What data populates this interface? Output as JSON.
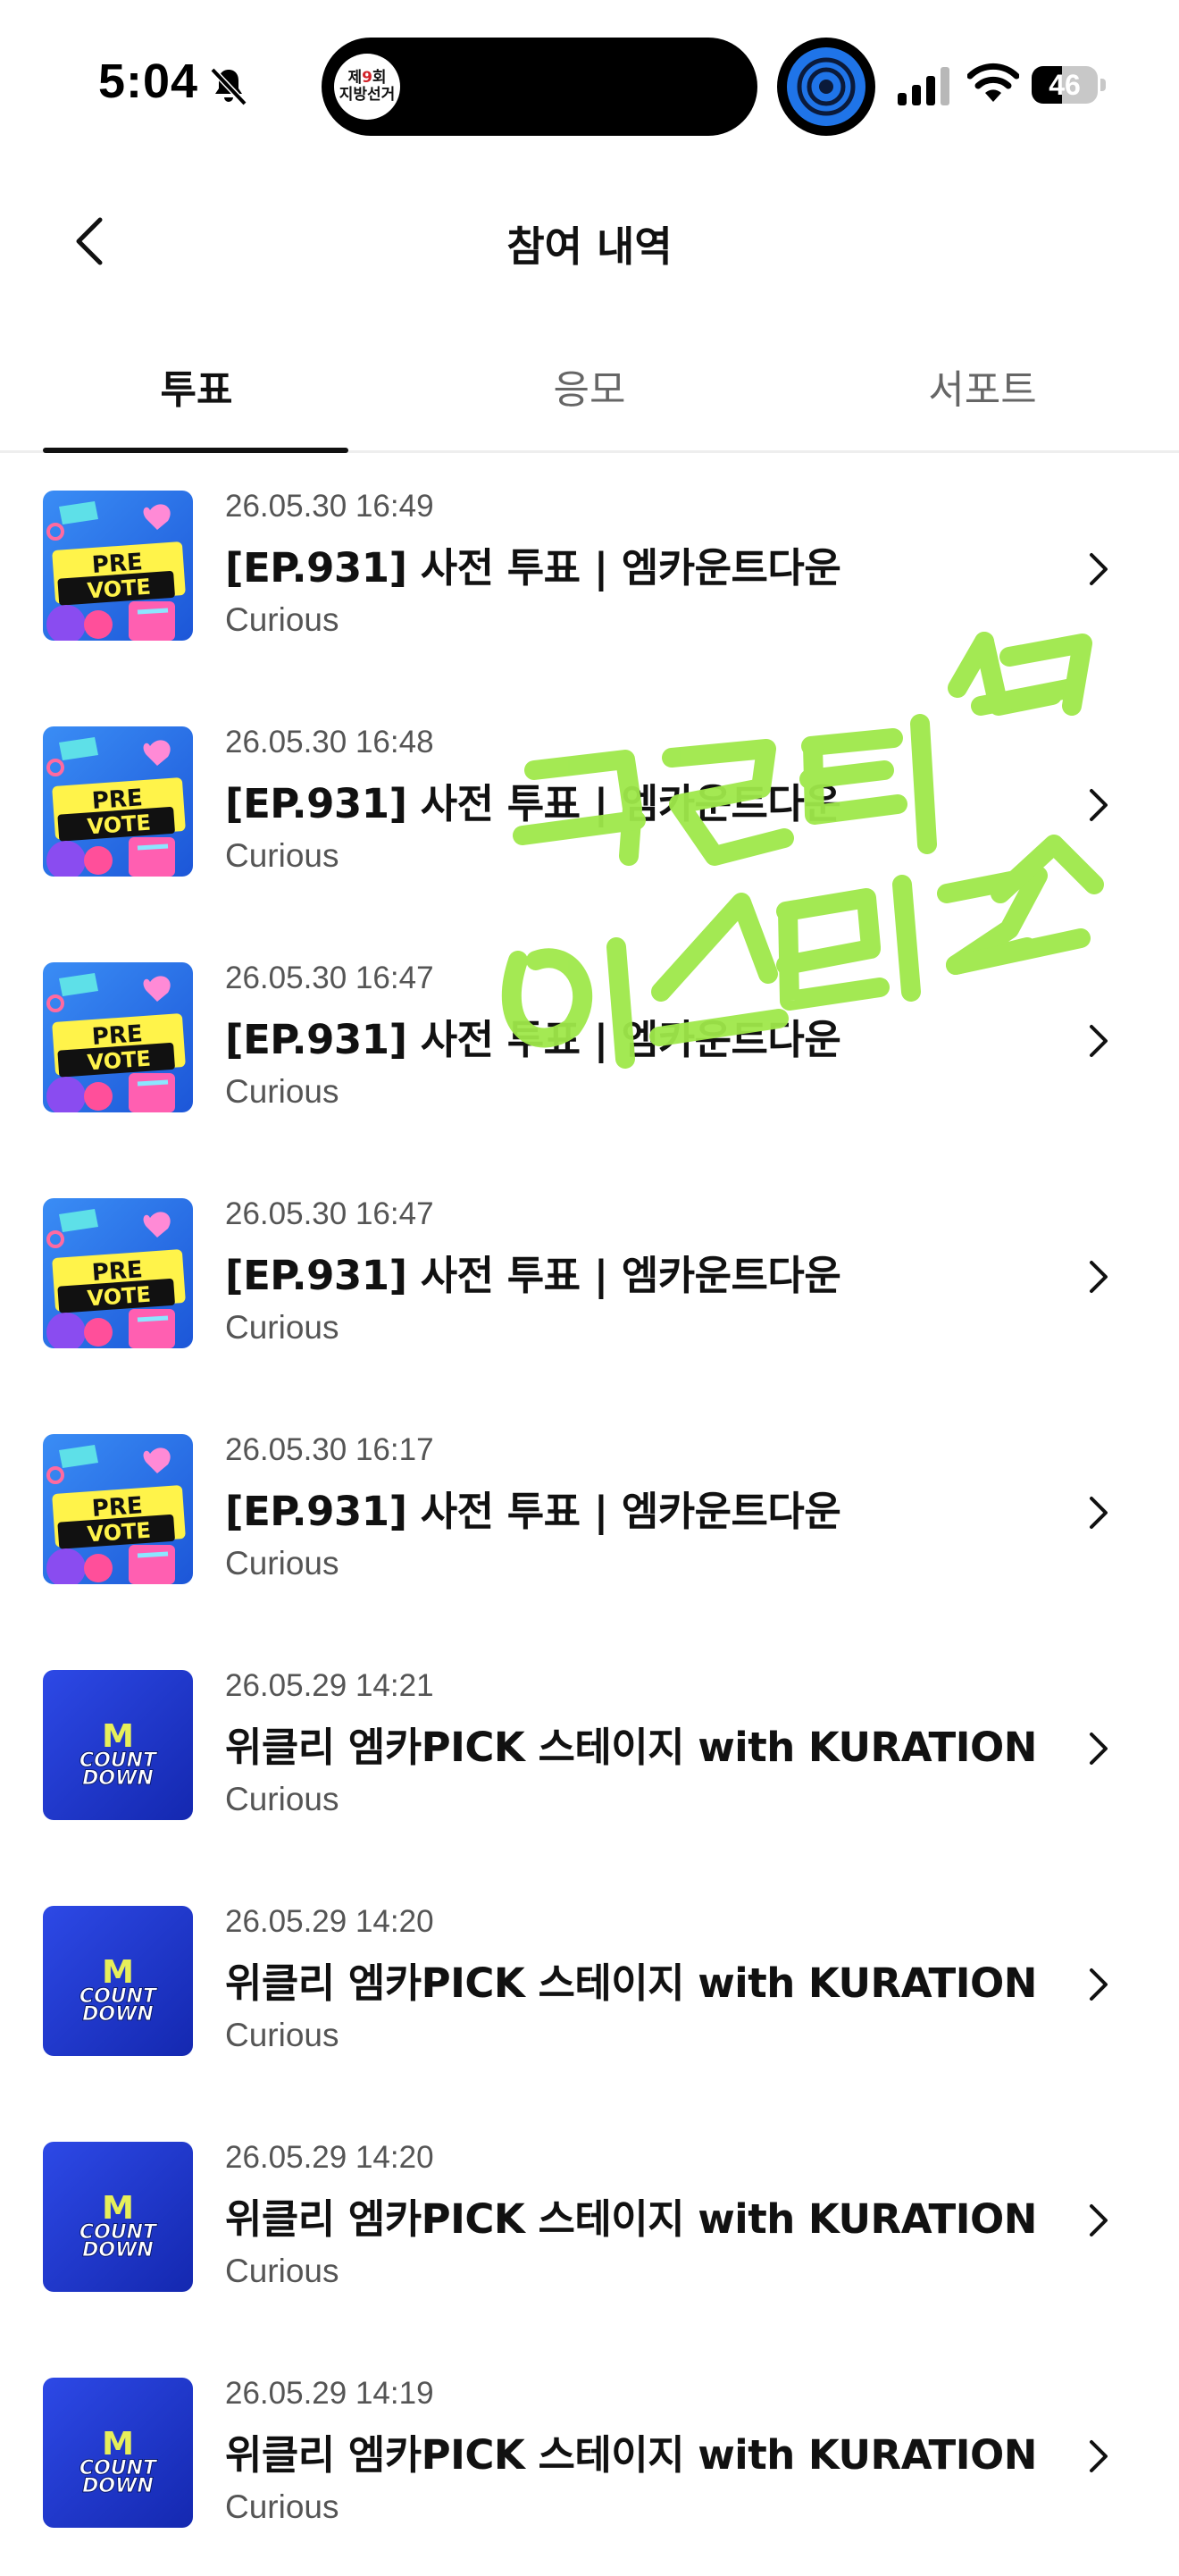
{
  "status_bar": {
    "time": "5:04",
    "election_badge_top": "제",
    "election_badge_num": "9",
    "election_badge_suffix": "회",
    "election_badge_bottom": "지방선거",
    "battery": "46",
    "battery_level": 0.46
  },
  "header": {
    "title": "참여 내역"
  },
  "tabs": [
    {
      "label": "투표",
      "active": true
    },
    {
      "label": "응모",
      "active": false
    },
    {
      "label": "서포트",
      "active": false
    }
  ],
  "items": [
    {
      "date": "26.05.30 16:49",
      "title": "[EP.931] 사전 투표 | 엠카운트다운",
      "subtitle": "Curious",
      "thumb": "pre-vote"
    },
    {
      "date": "26.05.30 16:48",
      "title": "[EP.931] 사전 투표 | 엠카운트다운",
      "subtitle": "Curious",
      "thumb": "pre-vote"
    },
    {
      "date": "26.05.30 16:47",
      "title": "[EP.931] 사전 투표 | 엠카운트다운",
      "subtitle": "Curious",
      "thumb": "pre-vote"
    },
    {
      "date": "26.05.30 16:47",
      "title": "[EP.931] 사전 투표 | 엠카운트다운",
      "subtitle": "Curious",
      "thumb": "pre-vote"
    },
    {
      "date": "26.05.30 16:17",
      "title": "[EP.931] 사전 투표 | 엠카운트다운",
      "subtitle": "Curious",
      "thumb": "pre-vote"
    },
    {
      "date": "26.05.29 14:21",
      "title": "위클리 엠카PICK 스테이지 with KURATION",
      "subtitle": "Curious",
      "thumb": "mcountdown"
    },
    {
      "date": "26.05.29 14:20",
      "title": "위클리 엠카PICK 스테이지 with KURATION",
      "subtitle": "Curious",
      "thumb": "mcountdown"
    },
    {
      "date": "26.05.29 14:20",
      "title": "위클리 엠카PICK 스테이지 with KURATION",
      "subtitle": "Curious",
      "thumb": "mcountdown"
    },
    {
      "date": "26.05.29 14:19",
      "title": "위클리 엠카PICK 스테이지 with KURATION",
      "subtitle": "Curious",
      "thumb": "mcountdown"
    }
  ],
  "thumbnails": {
    "pre_vote_line1": "PRE",
    "pre_vote_line2": "VOTE",
    "mcountdown_m": "M",
    "mcountdown_line1": "COUNT",
    "mcountdown_line2": "DOWN"
  },
  "colors": {
    "text_primary": "#111111",
    "text_secondary": "#555555",
    "tab_inactive": "#666666",
    "handwriting": "#9fe84a",
    "mcountdown_blue": "#1f3fd6"
  }
}
